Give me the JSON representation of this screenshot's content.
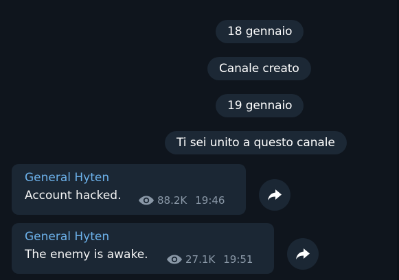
{
  "service_messages": [
    {
      "text": "18 gennaio"
    },
    {
      "text": "Canale creato"
    },
    {
      "text": "19 gennaio"
    },
    {
      "text": "Ti sei unito a questo canale"
    }
  ],
  "messages": [
    {
      "author": "General Hyten",
      "text": "Account hacked.",
      "views": "88.2K",
      "time": "19:46",
      "views_icon": "eye-icon",
      "action_icon": "share-icon"
    },
    {
      "author": "General Hyten",
      "text": "The enemy is awake.",
      "views": "27.1K",
      "time": "19:51",
      "views_icon": "eye-icon",
      "action_icon": "share-icon"
    }
  ],
  "colors": {
    "background": "#0f151d",
    "bubble": "#1b2734",
    "service_pill": "#1c2835",
    "author": "#6cb1ea",
    "meta": "#8a98a7"
  }
}
